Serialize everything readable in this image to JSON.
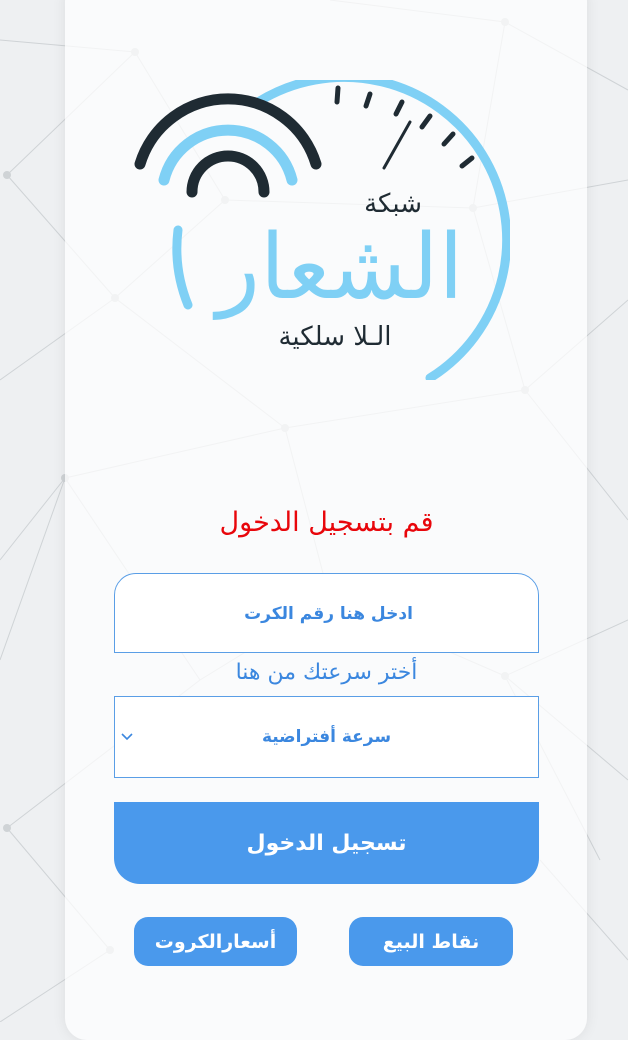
{
  "logo": {
    "network_label": "شبكة",
    "brand_name": "الشعار",
    "wireless_label": "الـلا سلكية"
  },
  "login": {
    "heading": "قم بتسجيل الدخول",
    "card_input_placeholder": "ادخل هنا رقم الكرت",
    "speed_prompt": "أختر سرعتك من هنا",
    "speed_selected": "سرعة أفتراضية",
    "submit_label": "تسجيل الدخول"
  },
  "footer": {
    "sales_points_label": "نقاط البيع",
    "card_prices_label": "أسعارالكروت"
  },
  "colors": {
    "accent_blue": "#4a99ec",
    "logo_light_blue": "#7fd0f5",
    "heading_red": "#e8060b",
    "logo_dark": "#1f2b33"
  }
}
